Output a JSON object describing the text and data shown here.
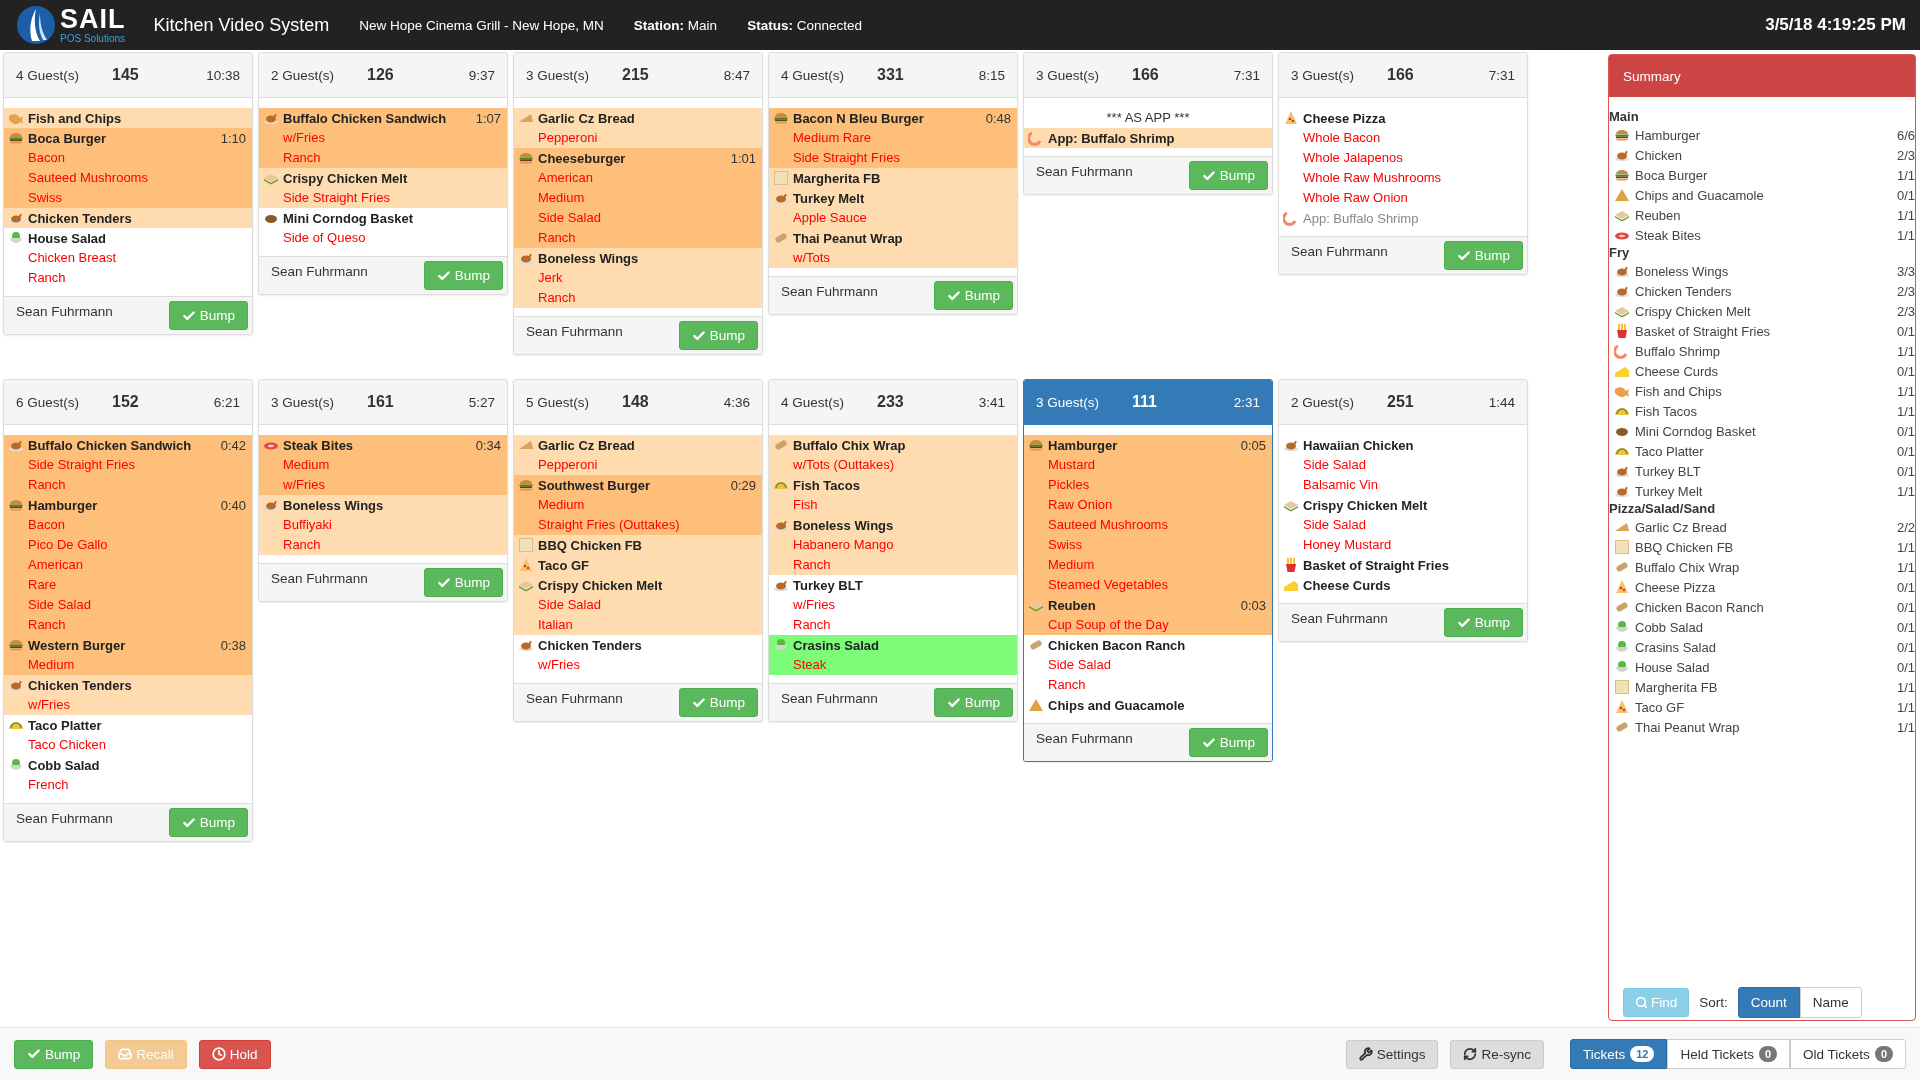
{
  "header": {
    "logo": {
      "name": "SAIL",
      "tagline": "POS Solutions"
    },
    "title": "Kitchen Video System",
    "location": "New Hope Cinema Grill - New Hope, MN",
    "station": "**Station:** Main",
    "status": "**Status:** Connected",
    "datetime": "3/5/18 4:19:25 PM"
  },
  "tickets": [
    {
      "guests": "4 Guest(s)",
      "number": "145",
      "time": "10:38",
      "selected": false,
      "server": "Sean Fuhrmann",
      "bump": "Bump",
      "items": [
        {
          "name": "Fish and Chips",
          "kind": "fish",
          "color": "#fedcb0"
        },
        {
          "name": "Boca Burger",
          "kind": "burger",
          "color": "#fdbf7a",
          "time": "1:10",
          "mods": [
            "Bacon",
            "Sauteed Mushrooms",
            "Swiss"
          ]
        },
        {
          "name": "Chicken Tenders",
          "kind": "chicken",
          "color": "#fedcb0"
        },
        {
          "name": "House Salad",
          "kind": "salad",
          "color": "#ffffff",
          "mods": [
            "Chicken Breast",
            "Ranch"
          ]
        }
      ]
    },
    {
      "guests": "2 Guest(s)",
      "number": "126",
      "time": "9:37",
      "selected": false,
      "server": "Sean Fuhrmann",
      "bump": "Bump",
      "items": [
        {
          "name": "Buffalo Chicken Sandwich",
          "kind": "chicken",
          "color": "#fdbf7a",
          "time": "1:07",
          "mods": [
            "w/Fries",
            "Ranch"
          ]
        },
        {
          "name": "Crispy Chicken Melt",
          "kind": "sandwich",
          "color": "#fedcb0",
          "mods": [
            "Side Straight Fries"
          ]
        },
        {
          "name": "Mini Corndog Basket",
          "kind": "corndog",
          "color": "#ffffff",
          "mods": [
            "Side of Queso"
          ]
        }
      ]
    },
    {
      "guests": "3 Guest(s)",
      "number": "215",
      "time": "8:47",
      "selected": false,
      "server": "Sean Fuhrmann",
      "bump": "Bump",
      "items": [
        {
          "name": "Garlic Cz Bread",
          "kind": "bread",
          "color": "#fedcb0",
          "mods": [
            "Pepperoni"
          ]
        },
        {
          "name": "Cheeseburger",
          "kind": "burger",
          "color": "#fdbf7a",
          "time": "1:01",
          "mods": [
            "American",
            "Medium",
            "Side Salad",
            "Ranch"
          ]
        },
        {
          "name": "Boneless Wings",
          "kind": "chicken",
          "color": "#fedcb0",
          "mods": [
            "Jerk",
            "Ranch"
          ]
        }
      ]
    },
    {
      "guests": "4 Guest(s)",
      "number": "331",
      "time": "8:15",
      "selected": false,
      "server": "Sean Fuhrmann",
      "bump": "Bump",
      "items": [
        {
          "name": "Bacon N Bleu Burger",
          "kind": "burger",
          "color": "#fdbf7a",
          "time": "0:48",
          "mods": [
            "Medium Rare",
            "Side Straight Fries"
          ]
        },
        {
          "name": "Margherita FB",
          "kind": "flatbread",
          "color": "#fedcb0"
        },
        {
          "name": "Turkey Melt",
          "kind": "chicken",
          "color": "#fedcb0",
          "mods": [
            "Apple Sauce"
          ]
        },
        {
          "name": "Thai Peanut Wrap",
          "kind": "wrap",
          "color": "#fedcb0",
          "mods": [
            "w/Tots"
          ]
        }
      ]
    },
    {
      "guests": "3 Guest(s)",
      "number": "166",
      "time": "7:31",
      "selected": false,
      "note": "*** AS APP ***",
      "server": "Sean Fuhrmann",
      "bump": "Bump",
      "items": [
        {
          "name": "App: Buffalo Shrimp",
          "kind": "shrimp",
          "color": "#fedcb0"
        }
      ]
    },
    {
      "guests": "3 Guest(s)",
      "number": "166",
      "time": "7:31",
      "selected": false,
      "server": "Sean Fuhrmann",
      "bump": "Bump",
      "items": [
        {
          "name": "Cheese Pizza",
          "kind": "pizza",
          "color": "#ffffff",
          "mods": [
            "Whole Bacon",
            "Whole Jalapenos",
            "Whole Raw Mushrooms",
            "Whole Raw Onion"
          ]
        },
        {
          "name": "App: Buffalo Shrimp",
          "kind": "shrimp",
          "color": "#ffffff",
          "muted": true
        }
      ]
    },
    {
      "guests": "6 Guest(s)",
      "number": "152",
      "time": "6:21",
      "selected": false,
      "server": "Sean Fuhrmann",
      "bump": "Bump",
      "items": [
        {
          "name": "Buffalo Chicken Sandwich",
          "kind": "chicken",
          "color": "#fdbf7a",
          "time": "0:42",
          "mods": [
            "Side Straight Fries",
            "Ranch"
          ]
        },
        {
          "name": "Hamburger",
          "kind": "burger",
          "color": "#fdbf7a",
          "time": "0:40",
          "mods": [
            "Bacon",
            "Pico De Gallo",
            "American",
            "Rare",
            "Side Salad",
            "Ranch"
          ]
        },
        {
          "name": "Western Burger",
          "kind": "burger",
          "color": "#fdbf7a",
          "time": "0:38",
          "mods": [
            "Medium"
          ]
        },
        {
          "name": "Chicken Tenders",
          "kind": "chicken",
          "color": "#fedcb0",
          "mods": [
            "w/Fries"
          ]
        },
        {
          "name": "Taco Platter",
          "kind": "taco",
          "color": "#ffffff",
          "mods": [
            "Taco Chicken"
          ]
        },
        {
          "name": "Cobb Salad",
          "kind": "salad",
          "color": "#ffffff",
          "mods": [
            "French"
          ]
        }
      ]
    },
    {
      "guests": "3 Guest(s)",
      "number": "161",
      "time": "5:27",
      "selected": false,
      "server": "Sean Fuhrmann",
      "bump": "Bump",
      "items": [
        {
          "name": "Steak Bites",
          "kind": "steak",
          "color": "#fdbf7a",
          "time": "0:34",
          "mods": [
            "Medium",
            "w/Fries"
          ]
        },
        {
          "name": "Boneless Wings",
          "kind": "chicken",
          "color": "#fedcb0",
          "mods": [
            "Buffiyaki",
            "Ranch"
          ]
        }
      ]
    },
    {
      "guests": "5 Guest(s)",
      "number": "148",
      "time": "4:36",
      "selected": false,
      "server": "Sean Fuhrmann",
      "bump": "Bump",
      "items": [
        {
          "name": "Garlic Cz Bread",
          "kind": "bread",
          "color": "#fedcb0",
          "mods": [
            "Pepperoni"
          ]
        },
        {
          "name": "Southwest Burger",
          "kind": "burger",
          "color": "#fdbf7a",
          "time": "0:29",
          "mods": [
            "Medium",
            "Straight Fries (Outtakes)"
          ]
        },
        {
          "name": "BBQ Chicken FB",
          "kind": "flatbread",
          "color": "#fedcb0"
        },
        {
          "name": "Taco GF",
          "kind": "pizza",
          "color": "#fedcb0"
        },
        {
          "name": "Crispy Chicken Melt",
          "kind": "sandwich",
          "color": "#fedcb0",
          "mods": [
            "Side Salad",
            "Italian"
          ]
        },
        {
          "name": "Chicken Tenders",
          "kind": "chicken",
          "color": "#ffffff",
          "mods": [
            "w/Fries"
          ]
        }
      ]
    },
    {
      "guests": "4 Guest(s)",
      "number": "233",
      "time": "3:41",
      "selected": false,
      "server": "Sean Fuhrmann",
      "bump": "Bump",
      "items": [
        {
          "name": "Buffalo Chix Wrap",
          "kind": "wrap",
          "color": "#fedcb0",
          "mods": [
            "w/Tots (Outtakes)"
          ]
        },
        {
          "name": "Fish Tacos",
          "kind": "taco",
          "color": "#fedcb0",
          "mods": [
            "Fish"
          ]
        },
        {
          "name": "Boneless Wings",
          "kind": "chicken",
          "color": "#fedcb0",
          "mods": [
            "Habanero Mango",
            "Ranch"
          ]
        },
        {
          "name": "Turkey BLT",
          "kind": "chicken",
          "color": "#ffffff",
          "mods": [
            "w/Fries",
            "Ranch"
          ]
        },
        {
          "name": "Crasins Salad",
          "kind": "salad",
          "color": "#7dfc7a",
          "mods": [
            "Steak"
          ]
        }
      ]
    },
    {
      "guests": "3 Guest(s)",
      "number": "111",
      "time": "2:31",
      "selected": true,
      "server": "Sean Fuhrmann",
      "bump": "Bump",
      "items": [
        {
          "name": "Hamburger",
          "kind": "burger",
          "color": "#fdbf7a",
          "time": "0:05",
          "mods": [
            "Mustard",
            "Pickles",
            "Raw Onion",
            "Sauteed Mushrooms",
            "Swiss",
            "Medium",
            "Steamed Vegetables"
          ]
        },
        {
          "name": "Reuben",
          "kind": "sandwich",
          "color": "#fdbf7a",
          "time": "0:03",
          "mods": [
            "Cup Soup of the Day"
          ]
        },
        {
          "name": "Chicken Bacon Ranch",
          "kind": "wrap",
          "color": "#ffffff",
          "mods": [
            "Side Salad",
            "Ranch"
          ]
        },
        {
          "name": "Chips and Guacamole",
          "kind": "chips",
          "color": "#ffffff"
        }
      ]
    },
    {
      "guests": "2 Guest(s)",
      "number": "251",
      "time": "1:44",
      "selected": false,
      "server": "Sean Fuhrmann",
      "bump": "Bump",
      "items": [
        {
          "name": "Hawaiian Chicken",
          "kind": "chicken",
          "color": "#ffffff",
          "mods": [
            "Side Salad",
            "Balsamic Vin"
          ]
        },
        {
          "name": "Crispy Chicken Melt",
          "kind": "sandwich",
          "color": "#ffffff",
          "mods": [
            "Side Salad",
            "Honey Mustard"
          ]
        },
        {
          "name": "Basket of Straight Fries",
          "kind": "fries",
          "color": "#ffffff"
        },
        {
          "name": "Cheese Curds",
          "kind": "cheese",
          "color": "#ffffff"
        }
      ]
    }
  ],
  "summary": {
    "title": "Summary",
    "groups": [
      {
        "name": "Main",
        "items": [
          {
            "name": "Hamburger",
            "kind": "burger",
            "count": "6/6"
          },
          {
            "name": "Chicken",
            "kind": "chicken",
            "count": "2/3"
          },
          {
            "name": "Boca Burger",
            "kind": "burger",
            "count": "1/1"
          },
          {
            "name": "Chips and Guacamole",
            "kind": "chips",
            "count": "0/1"
          },
          {
            "name": "Reuben",
            "kind": "sandwich",
            "count": "1/1"
          },
          {
            "name": "Steak Bites",
            "kind": "steak",
            "count": "1/1"
          }
        ]
      },
      {
        "name": "Fry",
        "items": [
          {
            "name": "Boneless Wings",
            "kind": "chicken",
            "count": "3/3"
          },
          {
            "name": "Chicken Tenders",
            "kind": "chicken",
            "count": "2/3"
          },
          {
            "name": "Crispy Chicken Melt",
            "kind": "sandwich",
            "count": "2/3"
          },
          {
            "name": "Basket of Straight Fries",
            "kind": "fries",
            "count": "0/1"
          },
          {
            "name": "Buffalo Shrimp",
            "kind": "shrimp",
            "count": "1/1"
          },
          {
            "name": "Cheese Curds",
            "kind": "cheese",
            "count": "0/1"
          },
          {
            "name": "Fish and Chips",
            "kind": "fish",
            "count": "1/1"
          },
          {
            "name": "Fish Tacos",
            "kind": "taco",
            "count": "1/1"
          },
          {
            "name": "Mini Corndog Basket",
            "kind": "corndog",
            "count": "0/1"
          },
          {
            "name": "Taco Platter",
            "kind": "taco",
            "count": "0/1"
          },
          {
            "name": "Turkey BLT",
            "kind": "chicken",
            "count": "0/1"
          },
          {
            "name": "Turkey Melt",
            "kind": "chicken",
            "count": "1/1"
          }
        ]
      },
      {
        "name": "Pizza/Salad/Sand",
        "items": [
          {
            "name": "Garlic Cz Bread",
            "kind": "bread",
            "count": "2/2"
          },
          {
            "name": "BBQ Chicken FB",
            "kind": "flatbread",
            "count": "1/1"
          },
          {
            "name": "Buffalo Chix Wrap",
            "kind": "wrap",
            "count": "1/1"
          },
          {
            "name": "Cheese Pizza",
            "kind": "pizza",
            "count": "0/1"
          },
          {
            "name": "Chicken Bacon Ranch",
            "kind": "wrap",
            "count": "0/1"
          },
          {
            "name": "Cobb Salad",
            "kind": "salad",
            "count": "0/1"
          },
          {
            "name": "Crasins Salad",
            "kind": "salad",
            "count": "0/1"
          },
          {
            "name": "House Salad",
            "kind": "salad",
            "count": "0/1"
          },
          {
            "name": "Margherita FB",
            "kind": "flatbread",
            "count": "1/1"
          },
          {
            "name": "Taco GF",
            "kind": "pizza",
            "count": "1/1"
          },
          {
            "name": "Thai Peanut Wrap",
            "kind": "wrap",
            "count": "1/1"
          }
        ]
      }
    ],
    "find": "Find",
    "sort_label": "Sort:",
    "sort_options": [
      {
        "label": "Count",
        "selected": true
      },
      {
        "label": "Name",
        "selected": false
      }
    ]
  },
  "footer": {
    "actions": [
      {
        "label": "Bump",
        "kind": "bump",
        "disabled": false
      },
      {
        "label": "Recall",
        "kind": "recall",
        "disabled": true
      },
      {
        "label": "Hold",
        "kind": "hold",
        "disabled": false
      }
    ],
    "tools": [
      {
        "label": "Settings",
        "kind": "settings"
      },
      {
        "label": "Re-sync",
        "kind": "resync"
      }
    ],
    "tabs": [
      {
        "label": "Tickets",
        "count": "12",
        "selected": true
      },
      {
        "label": "Held Tickets",
        "count": "0",
        "selected": false
      },
      {
        "label": "Old Tickets",
        "count": "0",
        "selected": false
      }
    ]
  }
}
